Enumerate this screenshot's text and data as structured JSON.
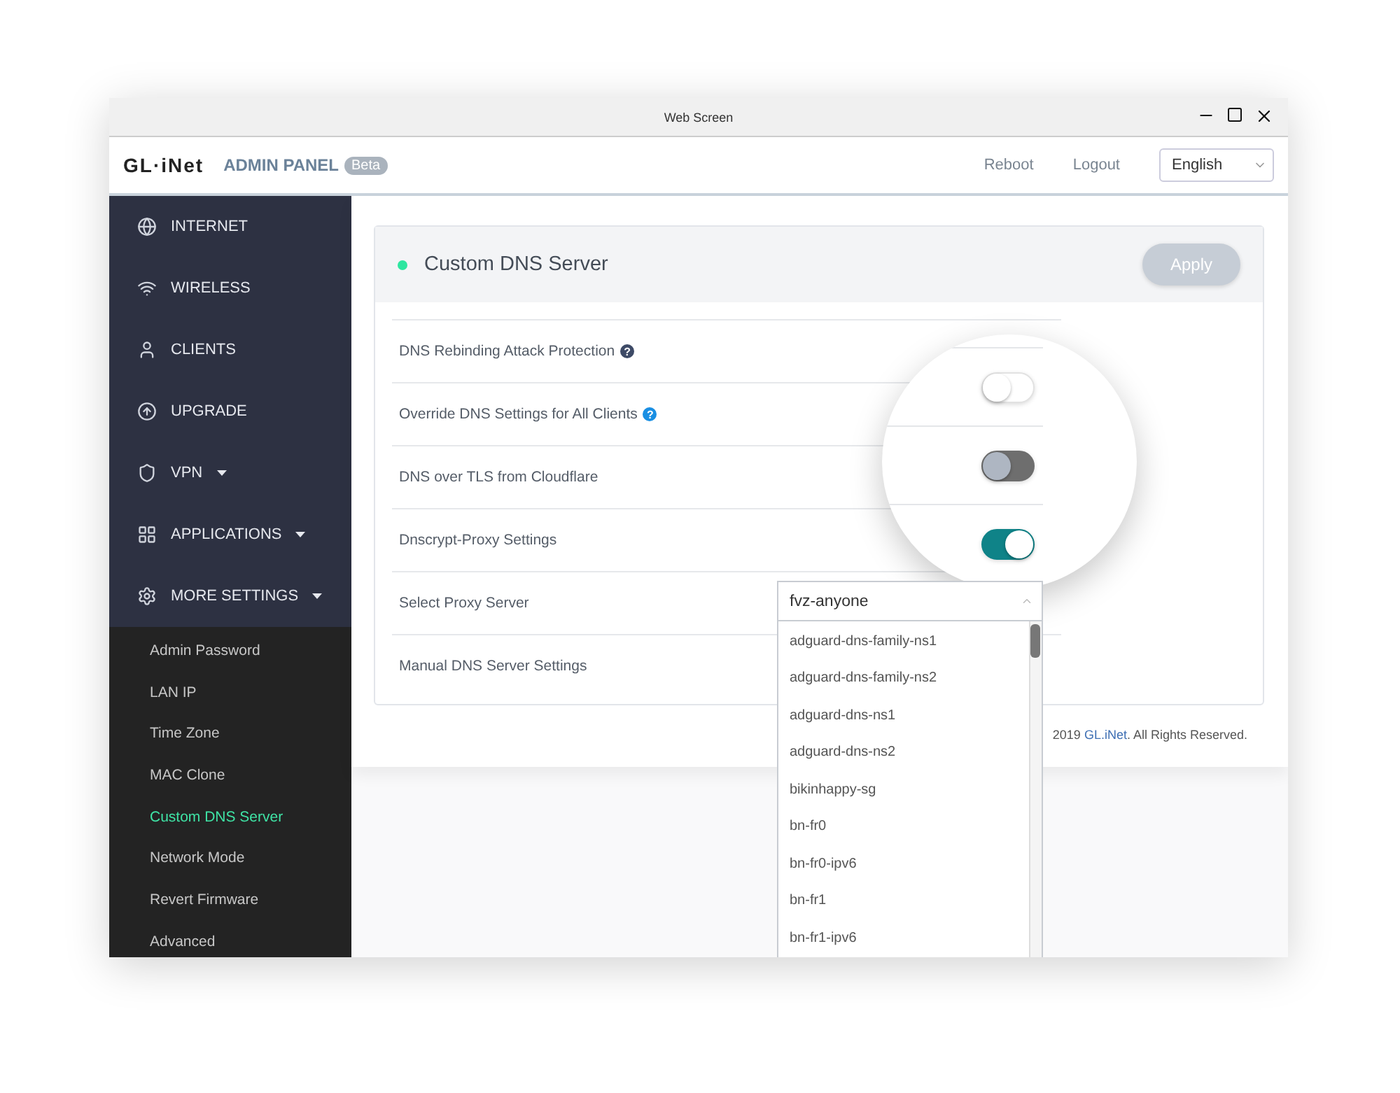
{
  "window": {
    "title": "Web Screen"
  },
  "header": {
    "logo": "GL·iNet",
    "product": "ADMIN PANEL",
    "badge": "Beta",
    "links": [
      "Reboot",
      "Logout"
    ],
    "language": "English"
  },
  "sidebar": {
    "items": [
      {
        "label": "INTERNET",
        "dropdown": false
      },
      {
        "label": "WIRELESS",
        "dropdown": false
      },
      {
        "label": "CLIENTS",
        "dropdown": false
      },
      {
        "label": "UPGRADE",
        "dropdown": false
      },
      {
        "label": "VPN",
        "dropdown": true
      },
      {
        "label": "APPLICATIONS",
        "dropdown": true
      },
      {
        "label": "MORE SETTINGS",
        "dropdown": true
      }
    ],
    "submenu": [
      {
        "label": "Admin Password",
        "selected": false
      },
      {
        "label": "LAN IP",
        "selected": false
      },
      {
        "label": "Time Zone",
        "selected": false
      },
      {
        "label": "MAC Clone",
        "selected": false
      },
      {
        "label": "Custom DNS Server",
        "selected": true
      },
      {
        "label": "Network Mode",
        "selected": false
      },
      {
        "label": "Revert Firmware",
        "selected": false
      },
      {
        "label": "Advanced",
        "selected": false
      }
    ]
  },
  "card": {
    "title": "Custom DNS Server",
    "apply": {
      "label": "Apply",
      "disabled": true
    },
    "rows": [
      {
        "label": "DNS Rebinding Attack Protection",
        "help": {
          "glyph": "?",
          "color": "#3d4a66"
        },
        "kind": "text"
      },
      {
        "label": "Override DNS Settings for All Clients",
        "help": {
          "glyph": "?",
          "color": "#1a8fe3"
        },
        "kind": "toggle",
        "on": false,
        "disabled": false
      },
      {
        "label": "DNS over TLS from Cloudflare",
        "kind": "toggle",
        "on": false,
        "disabled": true
      },
      {
        "label": "Dnscrypt-Proxy Settings",
        "kind": "toggle",
        "on": true,
        "disabled": false
      },
      {
        "label": "Select Proxy Server",
        "kind": "select"
      },
      {
        "label": "Manual DNS Server Settings",
        "kind": "text"
      }
    ]
  },
  "select": {
    "value": "fvz-anyone",
    "expanded": true,
    "options": [
      "adguard-dns-family-ns1",
      "adguard-dns-family-ns2",
      "adguard-dns-ns1",
      "adguard-dns-ns2",
      "bikinhappy-sg",
      "bn-fr0",
      "bn-fr0-ipv6",
      "bn-fr1",
      "bn-fr1-ipv6"
    ]
  },
  "footer": {
    "year": "2019",
    "link": "GL.iNet",
    "text": ". All Rights Reserved."
  }
}
